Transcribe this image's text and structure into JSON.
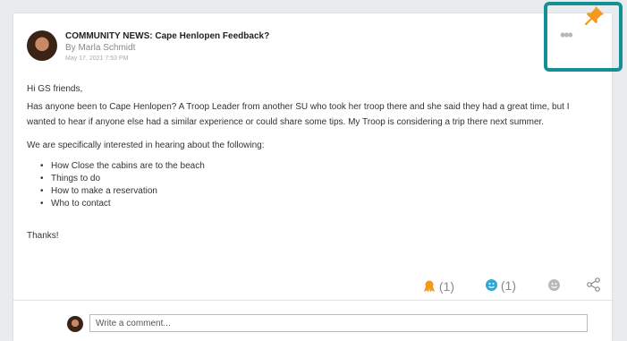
{
  "post": {
    "title": "COMMUNITY NEWS: Cape Henlopen Feedback?",
    "author": "By Marla Schmidt",
    "date": "May 17, 2021 7:53 PM",
    "greeting": "Hi GS friends,",
    "paragraph": "Has anyone been to Cape Henlopen? A Troop Leader from another SU who took her troop there and she said they had a great time, but I wanted to hear if anyone else had a similar experience or could share some tips. My Troop is considering a trip there next summer.",
    "interest_line": "We are specifically interested in hearing about the following:",
    "bullets": [
      "How Close the cabins are to the beach",
      "Things to do",
      "How to make a reservation",
      "Who to contact"
    ],
    "closing": "Thanks!"
  },
  "actions": {
    "more_label": "•••"
  },
  "reactions": {
    "badge_count": "(1)",
    "smile_count": "(1)"
  },
  "comment": {
    "placeholder": "Write a comment..."
  },
  "colors": {
    "highlight": "#149095",
    "pin": "#f39a1d",
    "smile": "#2fa8d8"
  }
}
